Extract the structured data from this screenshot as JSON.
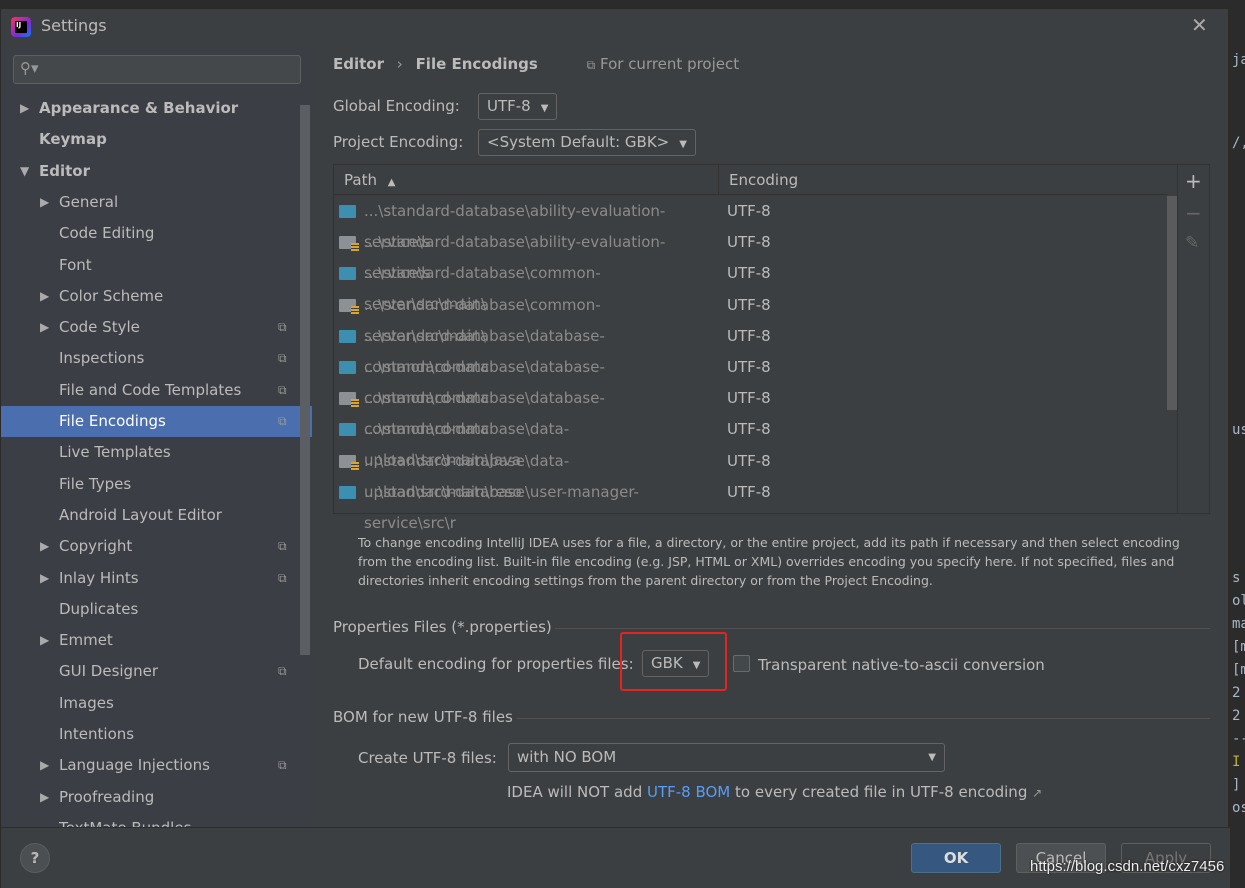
{
  "window": {
    "title": "Settings",
    "close_icon": "close-icon"
  },
  "sidebar": {
    "search_placeholder": "",
    "items": [
      {
        "label": "Appearance & Behavior",
        "bold": true,
        "arrow": "right",
        "level": 0
      },
      {
        "label": "Keymap",
        "bold": true,
        "level": 0
      },
      {
        "label": "Editor",
        "bold": true,
        "arrow": "down",
        "level": 0
      },
      {
        "label": "General",
        "arrow": "right",
        "level": 1
      },
      {
        "label": "Code Editing",
        "level": 1
      },
      {
        "label": "Font",
        "level": 1
      },
      {
        "label": "Color Scheme",
        "arrow": "right",
        "level": 1
      },
      {
        "label": "Code Style",
        "arrow": "right",
        "level": 1,
        "project": true
      },
      {
        "label": "Inspections",
        "level": 1,
        "project": true
      },
      {
        "label": "File and Code Templates",
        "level": 1,
        "project": true
      },
      {
        "label": "File Encodings",
        "level": 1,
        "project": true,
        "selected": true
      },
      {
        "label": "Live Templates",
        "level": 1
      },
      {
        "label": "File Types",
        "level": 1
      },
      {
        "label": "Android Layout Editor",
        "level": 1
      },
      {
        "label": "Copyright",
        "arrow": "right",
        "level": 1,
        "project": true
      },
      {
        "label": "Inlay Hints",
        "arrow": "right",
        "level": 1,
        "project": true
      },
      {
        "label": "Duplicates",
        "level": 1
      },
      {
        "label": "Emmet",
        "arrow": "right",
        "level": 1
      },
      {
        "label": "GUI Designer",
        "level": 1,
        "project": true
      },
      {
        "label": "Images",
        "level": 1
      },
      {
        "label": "Intentions",
        "level": 1
      },
      {
        "label": "Language Injections",
        "arrow": "right",
        "level": 1,
        "project": true
      },
      {
        "label": "Proofreading",
        "arrow": "right",
        "level": 1
      },
      {
        "label": "TextMate Bundles",
        "level": 1
      }
    ]
  },
  "main": {
    "breadcrumb": {
      "parent": "Editor",
      "sep": "›",
      "current": "File Encodings",
      "scope": "For current project"
    },
    "global_encoding": {
      "label": "Global Encoding:",
      "value": "UTF-8"
    },
    "project_encoding": {
      "label": "Project Encoding:",
      "value": "<System Default: GBK>"
    },
    "table": {
      "columns": [
        "Path",
        "Encoding"
      ],
      "sort": "ascending",
      "rows": [
        {
          "path": "...\\standard-database\\ability-evaluation-service\\s",
          "encoding": "UTF-8",
          "icon": "source-folder"
        },
        {
          "path": "...\\standard-database\\ability-evaluation-service\\s",
          "encoding": "UTF-8",
          "icon": "resource-folder"
        },
        {
          "path": "...\\standard-database\\common-server\\src\\main\\",
          "encoding": "UTF-8",
          "icon": "source-folder"
        },
        {
          "path": "...\\standard-database\\common-server\\src\\main\\",
          "encoding": "UTF-8",
          "icon": "resource-folder"
        },
        {
          "path": "...\\standard-database\\database-common\\commc",
          "encoding": "UTF-8",
          "icon": "source-folder"
        },
        {
          "path": "...\\standard-database\\database-common\\commc",
          "encoding": "UTF-8",
          "icon": "source-folder"
        },
        {
          "path": "...\\standard-database\\database-common\\commc",
          "encoding": "UTF-8",
          "icon": "resource-folder"
        },
        {
          "path": "...\\standard-database\\data-upload\\src\\main\\java",
          "encoding": "UTF-8",
          "icon": "source-folder"
        },
        {
          "path": "...\\standard-database\\data-upload\\src\\main\\reso",
          "encoding": "UTF-8",
          "icon": "resource-folder"
        },
        {
          "path": "...\\standard-database\\user-manager-service\\src\\r",
          "encoding": "UTF-8",
          "icon": "source-folder"
        }
      ],
      "tools": [
        "+",
        "−",
        "✎"
      ]
    },
    "hint": "To change encoding IntelliJ IDEA uses for a file, a directory, or the entire project, add its path if necessary and then select encoding from the encoding list. Built-in file encoding (e.g. JSP, HTML or XML) overrides encoding you specify here. If not specified, files and directories inherit encoding settings from the parent directory or from the Project Encoding.",
    "properties": {
      "section": "Properties Files (*.properties)",
      "label": "Default encoding for properties files:",
      "value": "GBK",
      "transparent_label": "Transparent native-to-ascii conversion",
      "transparent_checked": false,
      "highlight_color": "#e8221e"
    },
    "bom": {
      "section": "BOM for new UTF-8 files",
      "label": "Create UTF-8 files:",
      "value": "with NO BOM",
      "note_prefix": "IDEA will NOT add ",
      "note_link": "UTF-8 BOM",
      "note_suffix": " to every created file in UTF-8 encoding",
      "note_arrow": "↗"
    }
  },
  "footer": {
    "help": "?",
    "ok": "OK",
    "cancel": "Cancel",
    "apply": "Apply"
  },
  "watermark": "https://blog.csdn.net/cxz7456",
  "colors": {
    "selection": "#4b6eaf",
    "link": "#589df6",
    "ok": "#365880"
  }
}
